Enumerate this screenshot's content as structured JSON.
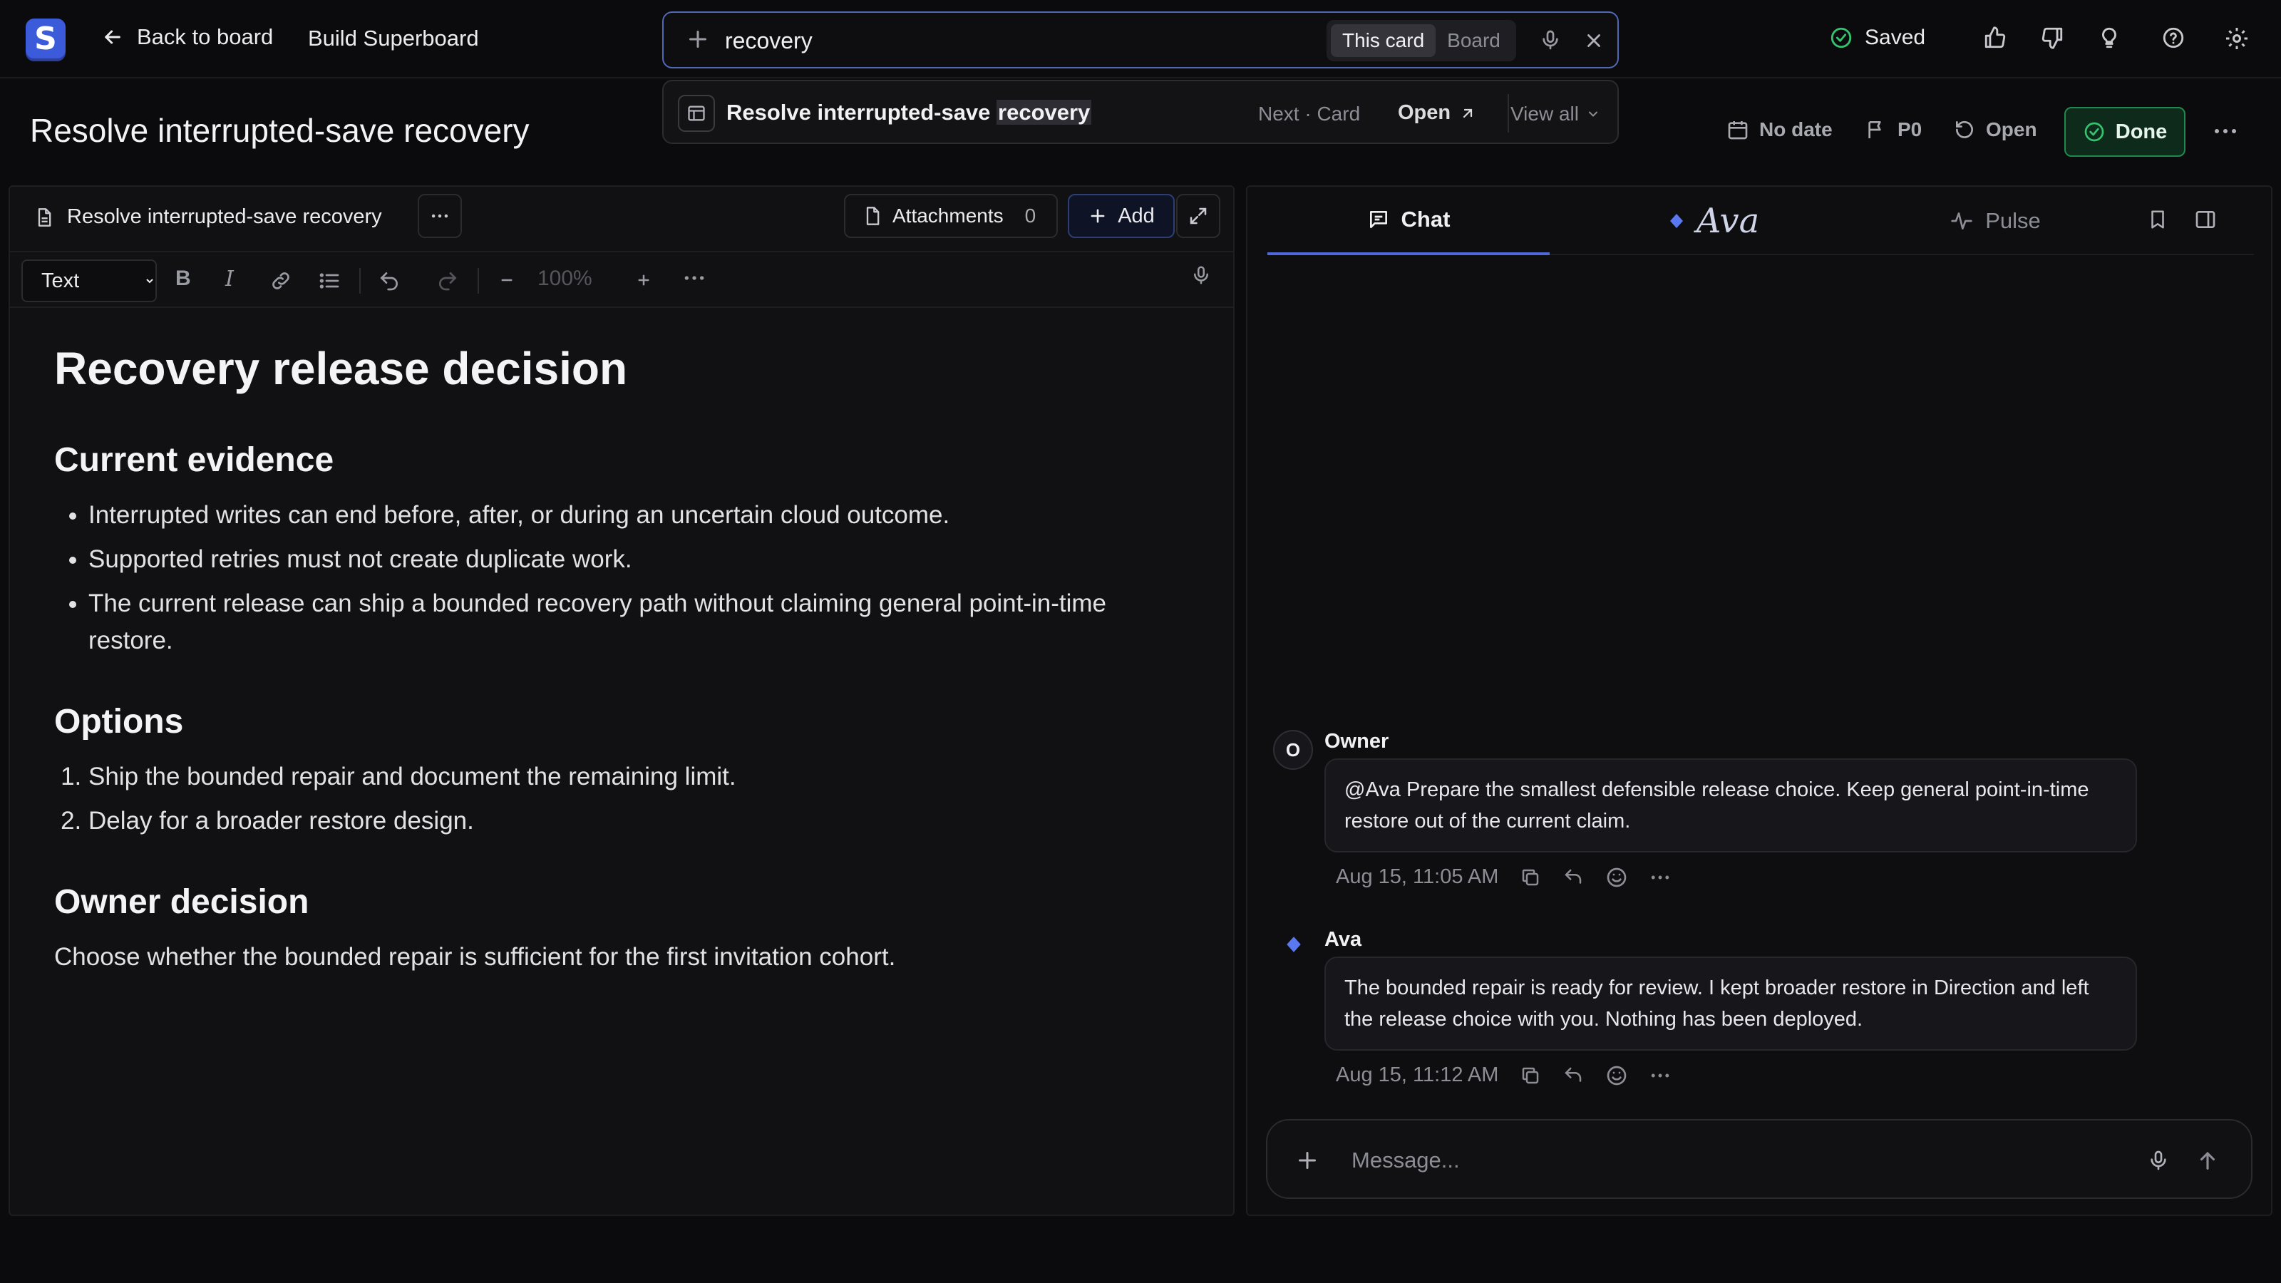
{
  "app": {
    "logo_letter": "S"
  },
  "header": {
    "back_label": "Back to board",
    "board_name": "Build Superboard",
    "saved_label": "Saved"
  },
  "search": {
    "value": "recovery",
    "scope_options": [
      "This card",
      "Board"
    ],
    "scope_selected": "This card",
    "result": {
      "title_before": "Resolve interrupted-save ",
      "title_match": "recovery",
      "meta": "Next · Card",
      "open_label": "Open",
      "view_all_label": "View all"
    }
  },
  "card": {
    "title": "Resolve interrupted-save recovery",
    "date_label": "No date",
    "priority": "P0",
    "status": "Open",
    "done_label": "Done"
  },
  "editor": {
    "doc_name": "Resolve interrupted-save recovery",
    "attachments_label": "Attachments",
    "attachments_count": "0",
    "add_label": "Add",
    "block_type": "Text",
    "zoom": "100%",
    "content": {
      "h1": "Recovery release decision",
      "evidence_heading": "Current evidence",
      "evidence": [
        "Interrupted writes can end before, after, or during an uncertain cloud outcome.",
        "Supported retries must not create duplicate work.",
        "The current release can ship a bounded recovery path without claiming general point-in-time restore."
      ],
      "options_heading": "Options",
      "options": [
        "Ship the bounded repair and document the remaining limit.",
        "Delay for a broader restore design."
      ],
      "decision_heading": "Owner decision",
      "decision_text": "Choose whether the bounded repair is sufficient for the first invitation cohort."
    }
  },
  "chat": {
    "tabs": {
      "chat": "Chat",
      "ava": "Ava",
      "pulse": "Pulse"
    },
    "messages": [
      {
        "sender": "Owner",
        "avatar": "O",
        "text": "@Ava Prepare the smallest defensible release choice. Keep general point-in-time restore out of the current claim.",
        "time": "Aug 15, 11:05 AM"
      },
      {
        "sender": "Ava",
        "avatar": "ava-diamond",
        "text": "The bounded repair is ready for review. I kept broader restore in Direction and left the release choice with you. Nothing has been deployed.",
        "time": "Aug 15, 11:12 AM"
      }
    ],
    "composer_placeholder": "Message..."
  },
  "colors": {
    "accent": "#4f6ad8",
    "brand": "#3b5bdb",
    "success": "#1f8a4c",
    "background": "#0b0b0d"
  }
}
